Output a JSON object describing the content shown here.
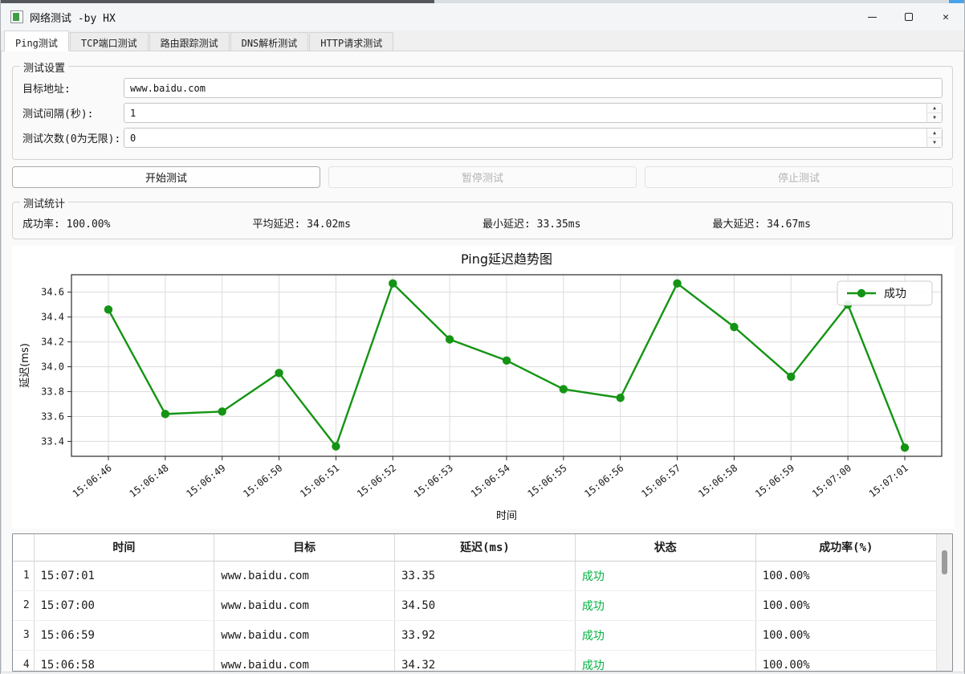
{
  "window": {
    "title": "网络测试 -by HX"
  },
  "tabs": [
    {
      "label": "Ping测试",
      "active": true
    },
    {
      "label": "TCP端口测试",
      "active": false
    },
    {
      "label": "路由跟踪测试",
      "active": false
    },
    {
      "label": "DNS解析测试",
      "active": false
    },
    {
      "label": "HTTP请求测试",
      "active": false
    }
  ],
  "settings": {
    "group_title": "测试设置",
    "fields": [
      {
        "name": "target-address",
        "label": "目标地址:",
        "value": "www.baidu.com",
        "spinner": false
      },
      {
        "name": "test-interval",
        "label": "测试间隔(秒):",
        "value": "1",
        "spinner": true
      },
      {
        "name": "test-count",
        "label": "测试次数(0为无限):",
        "value": "0",
        "spinner": true
      }
    ]
  },
  "buttons": [
    {
      "name": "start-test-button",
      "label": "开始测试",
      "enabled": true
    },
    {
      "name": "pause-test-button",
      "label": "暂停测试",
      "enabled": false
    },
    {
      "name": "stop-test-button",
      "label": "停止测试",
      "enabled": false
    }
  ],
  "stats": {
    "group_title": "测试统计",
    "items": [
      {
        "label": "成功率:",
        "value": "100.00%"
      },
      {
        "label": "平均延迟:",
        "value": "34.02ms"
      },
      {
        "label": "最小延迟:",
        "value": "33.35ms"
      },
      {
        "label": "最大延迟:",
        "value": "34.67ms"
      }
    ]
  },
  "chart_data": {
    "type": "line",
    "title": "Ping延迟趋势图",
    "xlabel": "时间",
    "ylabel": "延迟(ms)",
    "x": [
      "15:06:46",
      "15:06:48",
      "15:06:49",
      "15:06:50",
      "15:06:51",
      "15:06:52",
      "15:06:53",
      "15:06:54",
      "15:06:55",
      "15:06:56",
      "15:06:57",
      "15:06:58",
      "15:06:59",
      "15:07:00",
      "15:07:01"
    ],
    "series": [
      {
        "name": "成功",
        "color": "#149414",
        "values": [
          34.46,
          33.62,
          33.64,
          33.95,
          33.36,
          34.67,
          34.22,
          34.05,
          33.82,
          33.75,
          34.67,
          34.32,
          33.92,
          34.5,
          33.35
        ]
      }
    ],
    "ylim": [
      33.28,
      34.74
    ],
    "yticks": [
      33.4,
      33.6,
      33.8,
      34.0,
      34.2,
      34.4,
      34.6
    ],
    "grid": true,
    "legend_position": "top-right"
  },
  "table": {
    "headers": [
      "时间",
      "目标",
      "延迟(ms)",
      "状态",
      "成功率(%)"
    ],
    "status_color": "#00b140",
    "rows": [
      {
        "num": "1",
        "time": "15:07:01",
        "target": "www.baidu.com",
        "latency": "33.35",
        "status": "成功",
        "rate": "100.00%"
      },
      {
        "num": "2",
        "time": "15:07:00",
        "target": "www.baidu.com",
        "latency": "34.50",
        "status": "成功",
        "rate": "100.00%"
      },
      {
        "num": "3",
        "time": "15:06:59",
        "target": "www.baidu.com",
        "latency": "33.92",
        "status": "成功",
        "rate": "100.00%"
      },
      {
        "num": "4",
        "time": "15:06:58",
        "target": "www.baidu.com",
        "latency": "34.32",
        "status": "成功",
        "rate": "100.00%"
      }
    ]
  }
}
